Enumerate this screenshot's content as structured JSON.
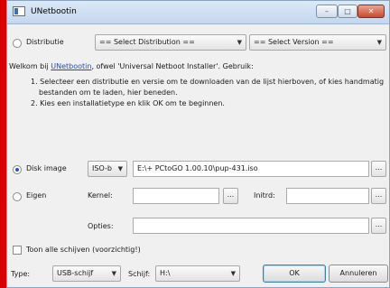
{
  "window": {
    "title": "UNetbootin",
    "min_glyph": "–",
    "max_glyph": "□",
    "close_glyph": "✕"
  },
  "distribution": {
    "radio_label": "Distributie",
    "select_distribution": "== Select Distribution ==",
    "select_version": "== Select Version =="
  },
  "intro": {
    "prefix": "Welkom bij ",
    "link": "UNetbootin",
    "suffix": ", ofwel 'Universal Netboot Installer'. Gebruik:",
    "step1_line1": "1. Selecteer een distributie en versie om te downloaden van de lijst hierboven, of kies handmatig",
    "step1_line2": "bestanden om te laden, hier beneden.",
    "step2": "2. Kies een installatietype en klik OK om te beginnen."
  },
  "diskimage": {
    "radio_label": "Disk image",
    "format": "ISO-b",
    "path": "E:\\+ PCtoGO 1.00.10\\pup-431.iso",
    "browse": "..."
  },
  "custom": {
    "radio_label": "Eigen",
    "kernel_label": "Kernel:",
    "kernel_value": "",
    "initrd_label": "Initrd:",
    "initrd_value": "",
    "options_label": "Opties:",
    "options_value": "",
    "browse": "..."
  },
  "show_all": {
    "label": "Toon alle schijven (voorzichtig!)"
  },
  "bottom": {
    "type_label": "Type:",
    "type_value": "USB-schijf",
    "drive_label": "Schijf:",
    "drive_value": "H:\\",
    "ok": "OK",
    "cancel": "Annuleren"
  },
  "icons": {
    "dropdown": "▼"
  }
}
